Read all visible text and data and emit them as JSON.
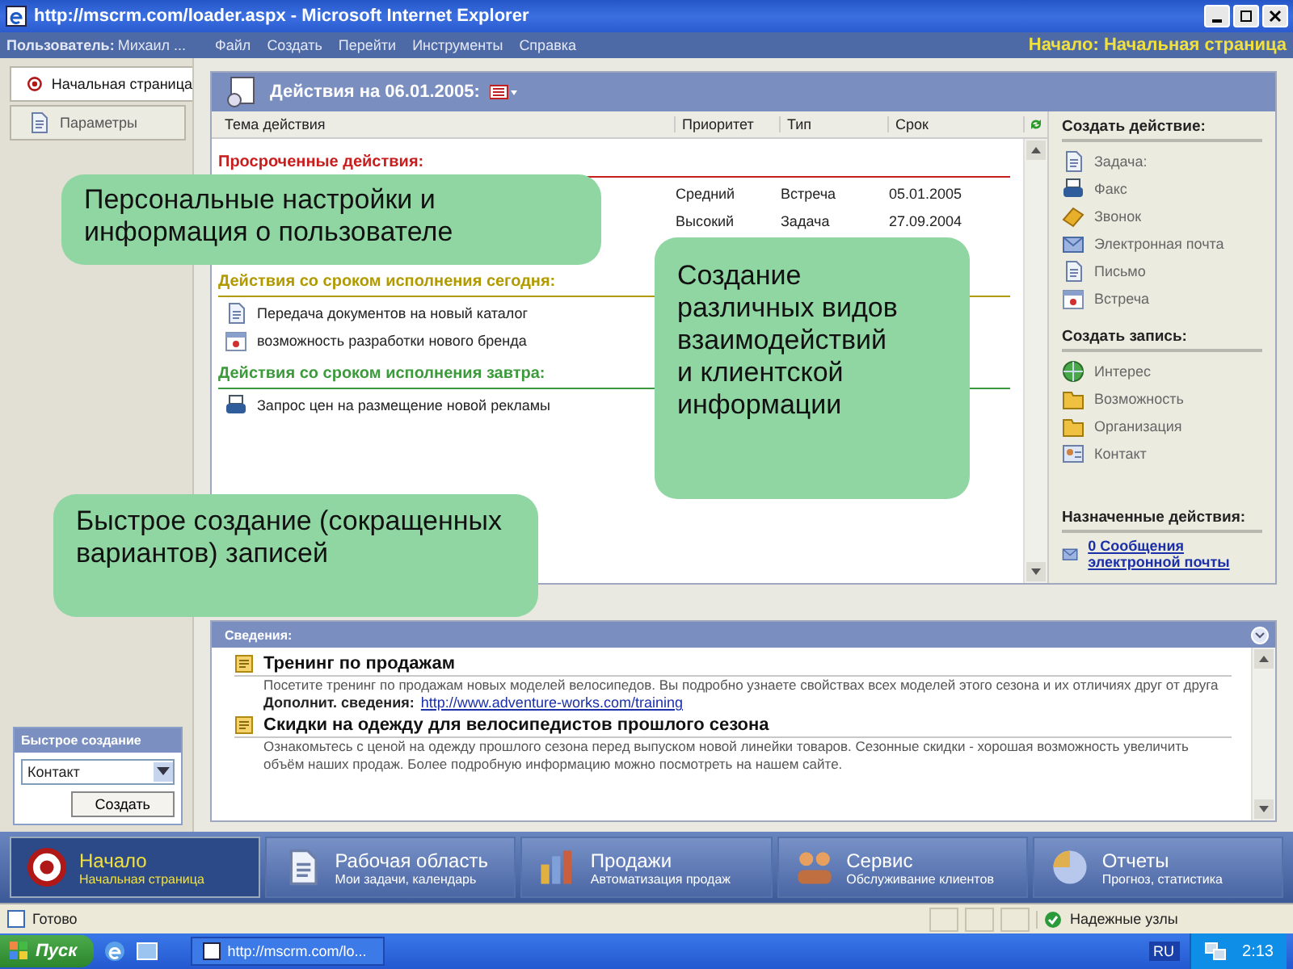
{
  "window": {
    "title": "http://mscrm.com/loader.aspx - Microsoft Internet Explorer"
  },
  "menubar": {
    "user_label": "Пользователь:",
    "user_name": "Михаил ...",
    "items": [
      "Файл",
      "Создать",
      "Перейти",
      "Инструменты",
      "Справка"
    ],
    "location": "Начало: Начальная страница"
  },
  "sidebar": {
    "items": [
      {
        "label": "Начальная страница",
        "selected": true,
        "kind": "home"
      },
      {
        "label": "Параметры",
        "selected": false,
        "kind": "settings"
      }
    ]
  },
  "quick_create": {
    "title": "Быстрое создание",
    "value": "Контакт",
    "button": "Создать"
  },
  "actions": {
    "title": "Действия на 06.01.2005:",
    "columns": [
      "Тема действия",
      "Приоритет",
      "Тип",
      "Срок"
    ],
    "groups": [
      {
        "title": "Просроченные действия:",
        "color": "#c81e1e",
        "rows": [
          {
            "priority": "Средний",
            "type": "Встреча",
            "due": "05.01.2005"
          },
          {
            "priority": "Высокий",
            "type": "Задача",
            "due": "27.09.2004"
          },
          {}
        ]
      },
      {
        "title": "Действия со сроком исполнения сегодня:",
        "color": "#b09a00",
        "rows": [
          {
            "kind": "letter",
            "subject": "Передача документов на новый каталог"
          },
          {
            "kind": "appointment",
            "subject": "возможность разработки нового бренда"
          }
        ]
      },
      {
        "title": "Действия со сроком исполнения завтра:",
        "color": "#3c9a3c",
        "rows": [
          {
            "kind": "fax",
            "subject": "Запрос цен на размещение новой рекламы"
          }
        ]
      }
    ]
  },
  "side_actions": [
    {
      "title": "Создать действие:",
      "items": [
        {
          "kind": "task",
          "label": "Задача:",
          "link": false
        },
        {
          "kind": "fax",
          "label": "Факс",
          "link": false
        },
        {
          "kind": "phone",
          "label": "Звонок",
          "link": false
        },
        {
          "kind": "email",
          "label": "Электронная почта",
          "link": false
        },
        {
          "kind": "letter",
          "label": "Письмо",
          "link": false
        },
        {
          "kind": "appointment",
          "label": "Встреча",
          "link": false
        }
      ]
    },
    {
      "title": "Создать запись:",
      "items": [
        {
          "kind": "lead",
          "label": "Интерес",
          "link": false
        },
        {
          "kind": "opportunity",
          "label": "Возможность",
          "link": false
        },
        {
          "kind": "account",
          "label": "Организация",
          "link": false
        },
        {
          "kind": "contact",
          "label": "Контакт",
          "link": false
        }
      ]
    },
    {
      "title": "Назначенные действия:",
      "items": [
        {
          "kind": "email",
          "label": "0 Сообщения электронной почты",
          "link": true
        }
      ]
    }
  ],
  "info": {
    "title": "Сведения:",
    "items": [
      {
        "title": "Тренинг по продажам",
        "text": "Посетите тренинг по продажам новых моделей велосипедов. Вы подробно узнаете свойствах всех моделей этого сезона и их отличиях друг от друга",
        "more_label": "Дополнит. сведения:",
        "more_link": "http://www.adventure-works.com/training"
      },
      {
        "title": "Скидки на одежду для велосипедистов прошлого сезона",
        "text": "Ознакомьтесь с ценой на одежду прошлого сезона перед выпуском новой линейки товаров. Сезонные скидки - хорошая возможность увеличить объём наших продаж. Более подробную информацию можно посмотреть на нашем сайте."
      }
    ]
  },
  "nav": [
    {
      "kind": "home",
      "title": "Начало",
      "subtitle": "Начальная страница",
      "selected": true
    },
    {
      "kind": "workplace",
      "title": "Рабочая область",
      "subtitle": "Мои задачи, календарь",
      "selected": false
    },
    {
      "kind": "sales",
      "title": "Продажи",
      "subtitle": "Автоматизация продаж",
      "selected": false
    },
    {
      "kind": "service",
      "title": "Сервис",
      "subtitle": "Обслуживание клиентов",
      "selected": false
    },
    {
      "kind": "reports",
      "title": "Отчеты",
      "subtitle": "Прогноз, статистика",
      "selected": false
    }
  ],
  "status_bar": {
    "text": "Готово",
    "zone": "Надежные узлы"
  },
  "taskbar": {
    "start": "Пуск",
    "task": "http://mscrm.com/lo...",
    "language": "RU",
    "clock": "2:13"
  },
  "callouts": [
    {
      "text": "Персональные настройки и информация о пользователе"
    },
    {
      "text": "Создание различных видов взаимодействий и клиентской информации"
    },
    {
      "text": "Быстрое создание (сокращенных вариантов) записей"
    }
  ]
}
